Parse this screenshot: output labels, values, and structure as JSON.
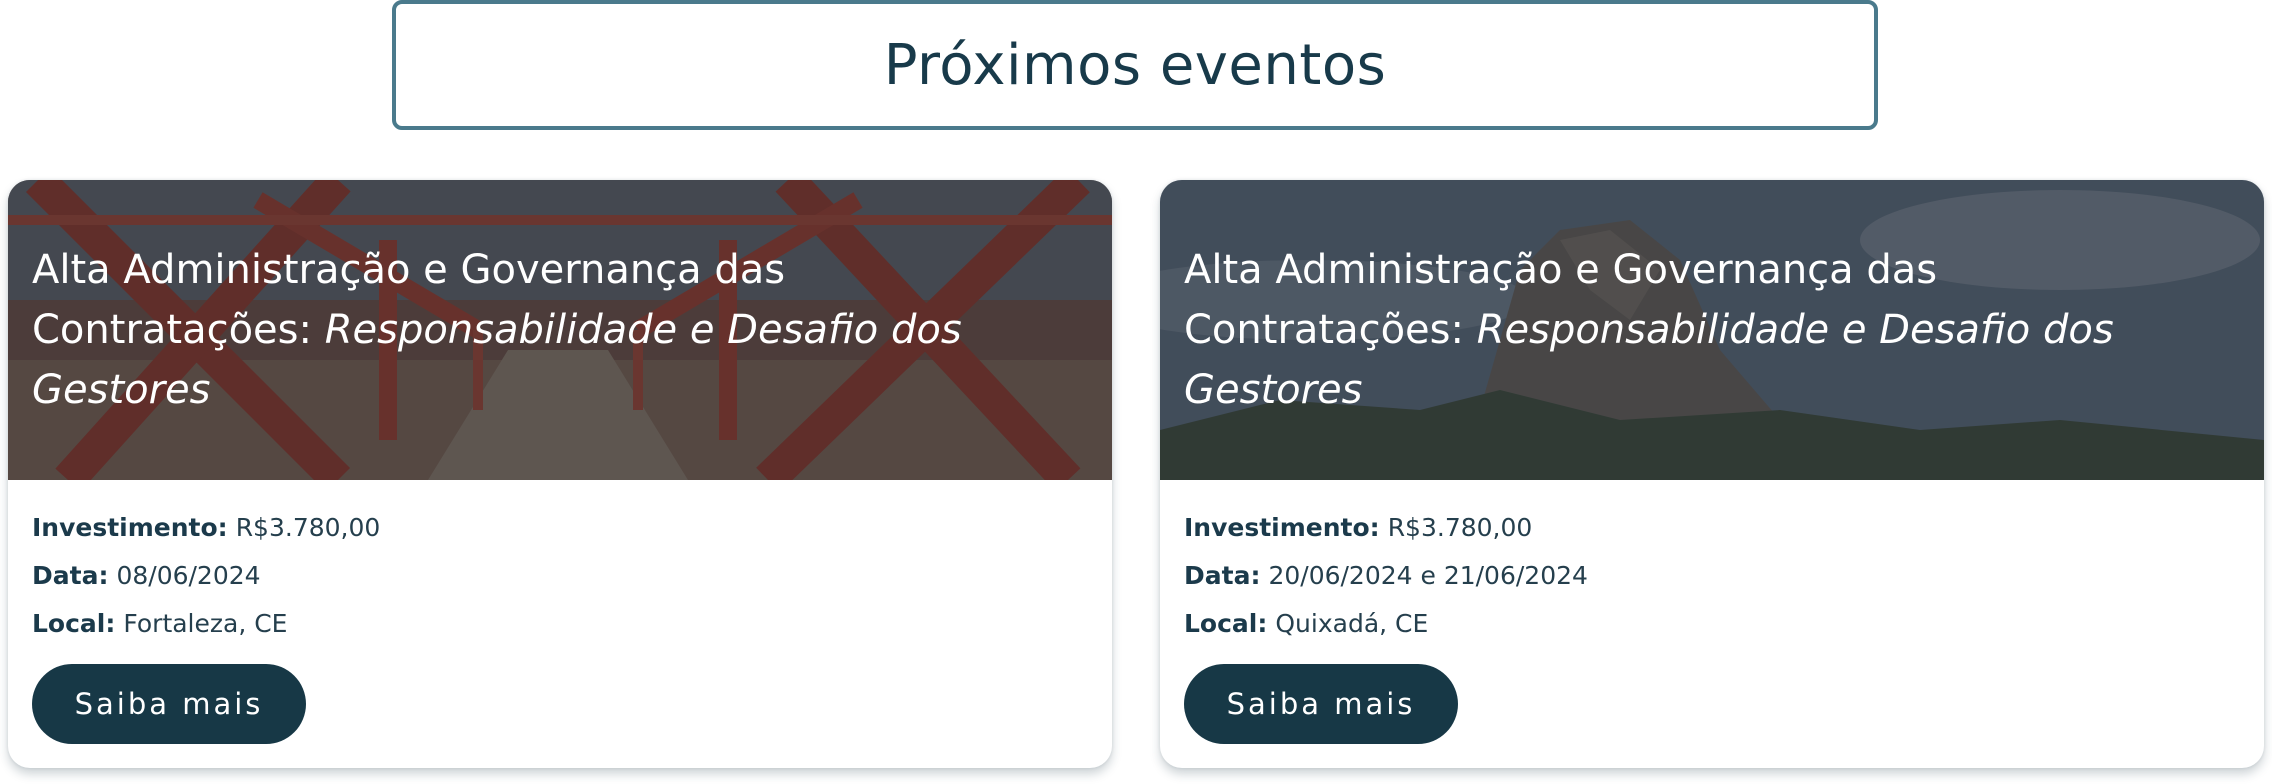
{
  "section": {
    "title": "Próximos eventos"
  },
  "events": [
    {
      "title_main": "Alta Administração e Governança das Contratações:",
      "title_sub": "Responsabilidade e Desafio dos Gestores",
      "investment_label": "Investimento:",
      "investment_value": "R$3.780,00",
      "date_label": "Data:",
      "date_value": "08/06/2024",
      "location_label": "Local:",
      "location_value": "Fortaleza, CE",
      "button_label": "Saiba mais",
      "image": "bridge-photo"
    },
    {
      "title_main": "Alta Administração e Governança das Contratações:",
      "title_sub": "Responsabilidade e Desafio dos Gestores",
      "investment_label": "Investimento:",
      "investment_value": "R$3.780,00",
      "date_label": "Data:",
      "date_value": "20/06/2024 e 21/06/2024",
      "location_label": "Local:",
      "location_value": "Quixadá, CE",
      "button_label": "Saiba mais",
      "image": "rock-mountain-photo"
    }
  ],
  "colors": {
    "primary": "#173846",
    "title_border": "#4a7a8c",
    "text": "#1b3a4b"
  }
}
